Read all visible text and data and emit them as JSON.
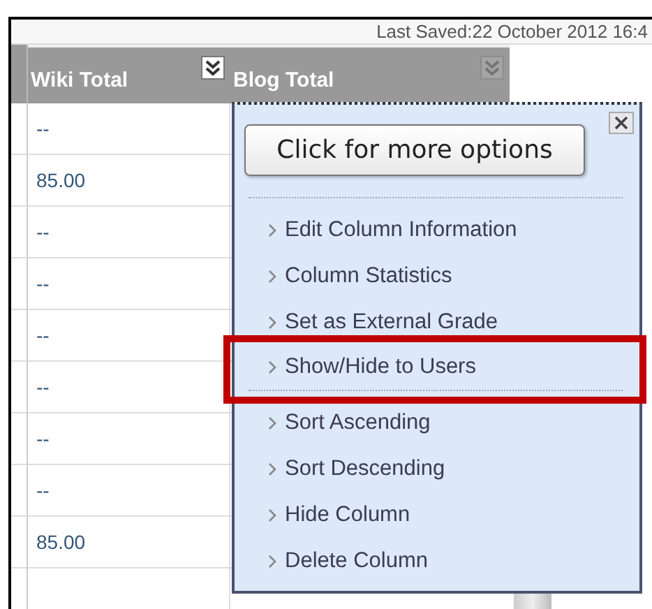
{
  "last_saved": "Last Saved:22 October 2012 16:4",
  "columns": [
    {
      "label": "Wiki Total",
      "menu_open": true
    },
    {
      "label": "Blog Total",
      "menu_open": false
    }
  ],
  "rows": [
    "--",
    "85.00",
    "--",
    "--",
    "--",
    "--",
    "--",
    "--",
    "85.00"
  ],
  "menu": {
    "tooltip": "Click for more options",
    "items": [
      {
        "label": "Edit Column Information",
        "highlighted": false,
        "divider_after": false
      },
      {
        "label": "Column Statistics",
        "highlighted": false,
        "divider_after": false
      },
      {
        "label": "Set as External Grade",
        "highlighted": false,
        "divider_after": false
      },
      {
        "label": "Show/Hide to Users",
        "highlighted": true,
        "divider_after": true
      },
      {
        "label": "Sort Ascending",
        "highlighted": false,
        "divider_after": false
      },
      {
        "label": "Sort Descending",
        "highlighted": false,
        "divider_after": false
      },
      {
        "label": "Hide Column",
        "highlighted": false,
        "divider_after": false
      },
      {
        "label": "Delete Column",
        "highlighted": false,
        "divider_after": false
      }
    ]
  }
}
